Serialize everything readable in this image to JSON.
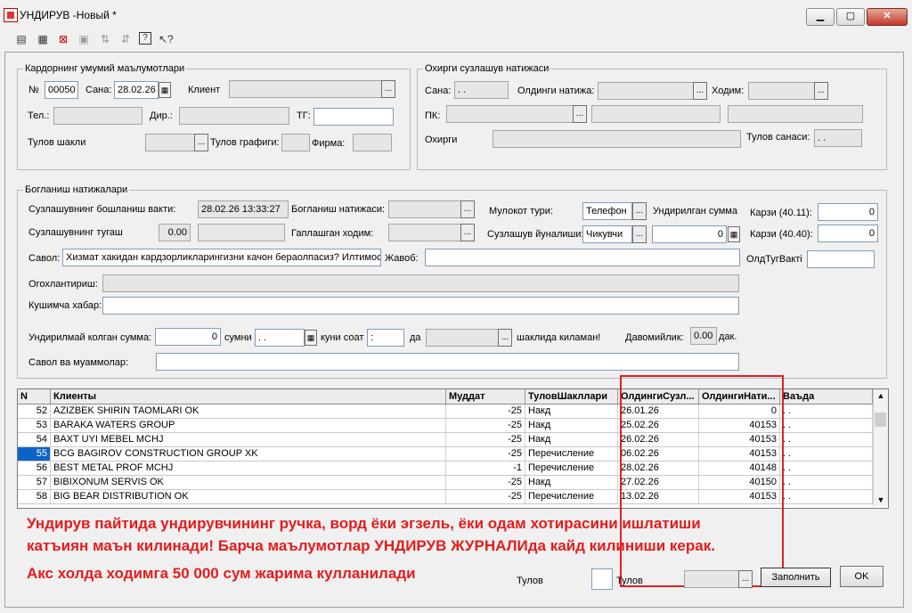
{
  "window": {
    "title": "УНДИРУВ -Новый *",
    "buttons": {
      "minimize": "▁",
      "maximize": "▢",
      "close": "✕"
    }
  },
  "toolbar": {
    "icons": [
      "new-icon",
      "add-row-icon",
      "delete-row-icon",
      "copy-icon",
      "sort-asc-icon",
      "sort-desc-icon",
      "help-icon",
      "pointer-help-icon"
    ]
  },
  "general": {
    "legend": "Кардорнинг умумий маълумотлари",
    "no_label": "№",
    "no_value": "00050",
    "date_label": "Сана:",
    "date_value": "28.02.26",
    "client_label": "Клиент",
    "client_value": "",
    "tel_label": "Тел.:",
    "tel_value": "",
    "dir_label": "Дир.:",
    "dir_value": "",
    "tg_label": "ТГ:",
    "tg_value": "",
    "pay_form_label": "Тулов шакли",
    "pay_form_value": "",
    "pay_schedule_label": "Тулов графиги:",
    "pay_schedule_value": "",
    "firm_label": "Фирма:",
    "firm_value": ""
  },
  "last_call": {
    "legend": "Охирги сузлашув натижаси",
    "date_label": "Сана:",
    "date_value": " .  .",
    "prev_result_label": "Олдинги натижа:",
    "prev_result_value": "",
    "staff_label": "Ходим:",
    "staff_value": "",
    "pk_label": "ПК:",
    "pk_value": "",
    "last_label": "Охирги",
    "last_value": "",
    "pay_date_label": "Тулов санаси:",
    "pay_date_value": " .  ."
  },
  "contact": {
    "legend": "Богланиш натижалари",
    "start_time_label": "Сузлашувнинг бошланиш вакти:",
    "start_time_value": "28.02.26 13:33:27",
    "end_label": "Сузлашувнинг тугаш",
    "end_value": "0.00",
    "end_value2": "",
    "result_label": "Богланиш натижаси:",
    "result_value": "",
    "spoken_staff_label": "Гаплашган ходим:",
    "spoken_staff_value": "",
    "meeting_type_label": "Мулокот тури:",
    "meeting_type_value": "Телефон",
    "direction_label": "Сузлашув йуналиши:",
    "direction_value": "Чикувчи",
    "collected_label": "Ундирилган сумма",
    "collected_value": "0",
    "debt1_label": "Карзи (40.11):",
    "debt1_value": "0",
    "debt2_label": "Карзи (40.40):",
    "debt2_value": "0",
    "prev_time_label": "ОлдТугВакті",
    "prev_time_value": "",
    "question_label": "Савол:",
    "question_value": "Хизмат хакидан кардзорликларингизни качон бераолпасиз? Илтимос",
    "answer_label": "Жавоб:",
    "answer_value": "",
    "warned_label": "Огохлантириш:",
    "warned_value": "",
    "extra_label": "Кушимча хабар:",
    "extra_value": "",
    "uncollected_label": "Ундирилмай колган сумма:",
    "uncollected_value": "0",
    "sum_label": "сумни",
    "sum_date": " .  .",
    "day_time_label": "куни соат",
    "day_time_value": " :",
    "da_label": "да",
    "da_value": "",
    "form_label": "шаклида киламан!",
    "duration_label": "Давомийлик:",
    "duration_value": "0.00",
    "duration_unit": "дак.",
    "problems_label": "Савол ва муаммолар:",
    "problems_value": ""
  },
  "grid": {
    "columns": [
      "N",
      "Клиенты",
      "Муддат",
      "ТуловШакллари",
      "ОлдингиСузл...",
      "ОлдингиНати...",
      "Ваъда"
    ],
    "rows": [
      {
        "n": "52",
        "client": "AZIZBEK SHIRIN TAOMLARI OK",
        "term": "-25",
        "pay": "Накд",
        "prev_date": "26.01.26",
        "prev_res": "0",
        "promise": ".  ."
      },
      {
        "n": "53",
        "client": "BARAKA WATERS GROUP",
        "term": "-25",
        "pay": "Накд",
        "prev_date": "25.02.26",
        "prev_res": "40153",
        "promise": ".  ."
      },
      {
        "n": "54",
        "client": "BAXT UYI MEBEL MCHJ",
        "term": "-25",
        "pay": "Накд",
        "prev_date": "26.02.26",
        "prev_res": "40153",
        "promise": ".  ."
      },
      {
        "n": "55",
        "client": "BCG BAGIROV CONSTRUCTION GROUP XK",
        "term": "-25",
        "pay": "Перечисление",
        "prev_date": "06.02.26",
        "prev_res": "40153",
        "promise": ".  ."
      },
      {
        "n": "56",
        "client": "BEST METAL PROF MCHJ",
        "term": "-1",
        "pay": "Перечисление",
        "prev_date": "28.02.26",
        "prev_res": "40148",
        "promise": ".  ."
      },
      {
        "n": "57",
        "client": "BIBIXONUM SERVIS OK",
        "term": "-25",
        "pay": "Накд",
        "prev_date": "27.02.26",
        "prev_res": "40150",
        "promise": ".  ."
      },
      {
        "n": "58",
        "client": "BIG BEAR DISTRIBUTION OK",
        "term": "-25",
        "pay": "Перечисление",
        "prev_date": "13.02.26",
        "prev_res": "40153",
        "promise": ".  ."
      }
    ]
  },
  "notice": {
    "line1": "Ундирув пайтида ундирувчининг ручка, ворд ёки эгзель, ёки одам хотирасини ишлатиши",
    "line2": "катъиян маън килинади! Барча маълумотлар УНДИРУВ ЖУРНАЛИда кайд килиниши керак.",
    "line3": "Акс холда ходимга 50 000 сум жарима кулланилади",
    "color": "#e41c1c"
  },
  "footer": {
    "pay1_label": "Тулов",
    "pay2_label": "Тулов",
    "pay2_value": "",
    "fill_button": "Заполнить",
    "ok_button": "OK"
  },
  "colors": {
    "highlight": "#e02020",
    "selected_row": "#0a64c8"
  }
}
